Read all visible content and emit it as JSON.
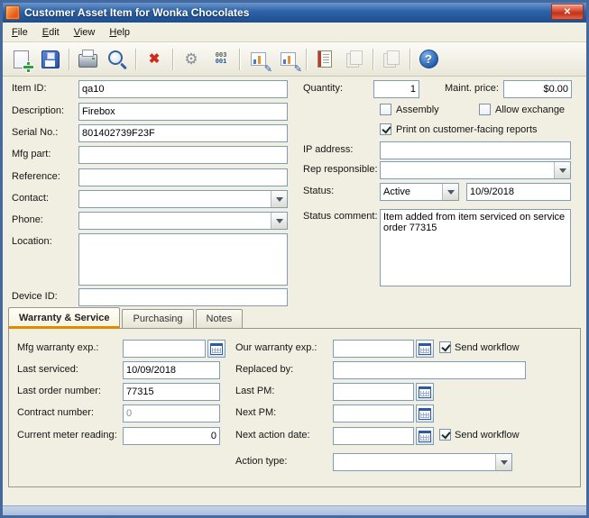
{
  "window": {
    "title": "Customer Asset Item for Wonka Chocolates",
    "close_glyph": "✕"
  },
  "menu": {
    "items": [
      "File",
      "Edit",
      "View",
      "Help"
    ]
  },
  "toolbar": {
    "icons": [
      {
        "name": "new-record"
      },
      {
        "name": "save"
      },
      {
        "name": "print"
      },
      {
        "name": "zoom"
      },
      {
        "name": "delete",
        "glyph": "✖"
      },
      {
        "name": "process",
        "glyph": "⚙"
      },
      {
        "name": "serial-numbers",
        "top": "003",
        "bottom": "001"
      },
      {
        "name": "analysis",
        "glyph": "✎"
      },
      {
        "name": "schedule",
        "glyph": "✎"
      },
      {
        "name": "note"
      },
      {
        "name": "links"
      },
      {
        "name": "copy"
      },
      {
        "name": "help",
        "glyph": "?"
      }
    ]
  },
  "form": {
    "item_id": {
      "label": "Item ID:",
      "value": "qa10"
    },
    "description": {
      "label": "Description:",
      "value": "Firebox"
    },
    "serial_no": {
      "label": "Serial No.:",
      "value": "801402739F23F"
    },
    "mfg_part": {
      "label": "Mfg  part:",
      "value": ""
    },
    "reference": {
      "label": "Reference:",
      "value": ""
    },
    "contact": {
      "label": "Contact:",
      "value": ""
    },
    "phone": {
      "label": "Phone:",
      "value": ""
    },
    "location": {
      "label": "Location:",
      "value": ""
    },
    "device_id": {
      "label": "Device ID:",
      "value": ""
    },
    "quantity": {
      "label": "Quantity:",
      "value": "1"
    },
    "maint_price": {
      "label": "Maint. price:",
      "value": "$0.00"
    },
    "assembly": {
      "label": "Assembly",
      "checked": false
    },
    "allow_exchange": {
      "label": "Allow exchange",
      "checked": false
    },
    "print_reports": {
      "label": "Print on customer-facing reports",
      "checked": true
    },
    "ip_address": {
      "label": "IP address:",
      "value": ""
    },
    "rep_responsible": {
      "label": "Rep responsible:",
      "value": ""
    },
    "status": {
      "label": "Status:",
      "value": "Active",
      "date": "10/9/2018"
    },
    "status_comment": {
      "label": "Status comment:",
      "value": "Item added from item serviced on service order 77315"
    }
  },
  "tabs": {
    "items": [
      {
        "label": "Warranty & Service",
        "active": true
      },
      {
        "label": "Purchasing",
        "active": false
      },
      {
        "label": "Notes",
        "active": false
      }
    ]
  },
  "warranty": {
    "mfg_warranty_exp": {
      "label": "Mfg warranty exp.:",
      "value": ""
    },
    "last_serviced": {
      "label": "Last serviced:",
      "value": "10/09/2018"
    },
    "last_order_number": {
      "label": "Last order number:",
      "value": "77315"
    },
    "contract_number": {
      "label": "Contract number:",
      "value": "0"
    },
    "current_meter_reading": {
      "label": "Current meter reading:",
      "value": "0"
    },
    "our_warranty_exp": {
      "label": "Our warranty exp.:",
      "value": ""
    },
    "send_workflow_warranty": {
      "label": "Send workflow",
      "checked": true
    },
    "replaced_by": {
      "label": "Replaced by:",
      "value": ""
    },
    "last_pm": {
      "label": "Last PM:",
      "value": ""
    },
    "next_pm": {
      "label": "Next PM:",
      "value": ""
    },
    "next_action_date": {
      "label": "Next action date:",
      "value": ""
    },
    "send_workflow_action": {
      "label": "Send workflow",
      "checked": true
    },
    "action_type": {
      "label": "Action type:",
      "value": ""
    }
  }
}
